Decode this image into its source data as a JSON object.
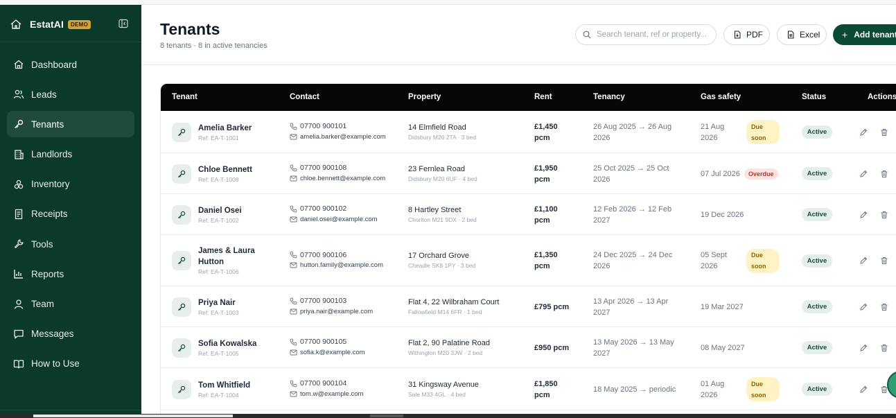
{
  "app": {
    "name": "EstatAI",
    "badge": "DEMO"
  },
  "sidebar": {
    "items": [
      {
        "label": "Dashboard",
        "icon": "home-icon",
        "active": false
      },
      {
        "label": "Leads",
        "icon": "users-icon",
        "active": false
      },
      {
        "label": "Tenants",
        "icon": "key-icon",
        "active": true
      },
      {
        "label": "Landlords",
        "icon": "building-icon",
        "active": false
      },
      {
        "label": "Inventory",
        "icon": "boxes-icon",
        "active": false
      },
      {
        "label": "Receipts",
        "icon": "receipt-icon",
        "active": false
      },
      {
        "label": "Tools",
        "icon": "wrench-icon",
        "active": false
      },
      {
        "label": "Reports",
        "icon": "bar-chart-icon",
        "active": false
      },
      {
        "label": "Team",
        "icon": "user-icon",
        "active": false
      },
      {
        "label": "Messages",
        "icon": "message-icon",
        "active": false
      },
      {
        "label": "How to Use",
        "icon": "book-icon",
        "active": false
      }
    ]
  },
  "header": {
    "title": "Tenants",
    "subtitle": "8 tenants · 8 in active tenancies",
    "search_placeholder": "Search tenant, ref or property...",
    "pdf_label": "PDF",
    "excel_label": "Excel",
    "add_label": "Add tenant"
  },
  "table": {
    "columns": [
      "Tenant",
      "Contact",
      "Property",
      "Rent",
      "Tenancy",
      "Gas safety",
      "Status",
      "Actions"
    ],
    "rows": [
      {
        "name": [
          "Amelia Barker"
        ],
        "ref": "Ref: EA-T-1001",
        "phone": "07700 900101",
        "email": "amelia.barker@example.com",
        "property": "14 Elmfield Road",
        "property_sub": "Didsbury M20 2TA · 3 bed",
        "rent": [
          "£1,450",
          "pcm"
        ],
        "tenancy": [
          "26 Aug 2025 → 26 Aug",
          "2026"
        ],
        "gas_date": [
          "21 Aug",
          "2026"
        ],
        "gas_badge": [
          "Due",
          "soon"
        ],
        "gas_type": "due",
        "status": "Active"
      },
      {
        "name": [
          "Chloe Bennett"
        ],
        "ref": "Ref: EA-T-1008",
        "phone": "07700 900108",
        "email": "chloe.bennett@example.com",
        "property": "23 Fernlea Road",
        "property_sub": "Didsbury M20 6UF · 4 bed",
        "rent": [
          "£1,950",
          "pcm"
        ],
        "tenancy": [
          "25 Oct 2025 → 25 Oct",
          "2026"
        ],
        "gas_date": [
          "07 Jul 2026"
        ],
        "gas_badge": [
          "Overdue"
        ],
        "gas_type": "overdue",
        "status": "Active"
      },
      {
        "name": [
          "Daniel Osei"
        ],
        "ref": "Ref: EA-T-1002",
        "phone": "07700 900102",
        "email": "daniel.osei@example.com",
        "property": "8 Hartley Street",
        "property_sub": "Chorlton M21 9DX · 2 bed",
        "rent": [
          "£1,100",
          "pcm"
        ],
        "tenancy": [
          "12 Feb 2026 → 12 Feb",
          "2027"
        ],
        "gas_date": [
          "19 Dec 2026"
        ],
        "gas_badge": [],
        "gas_type": "none",
        "status": "Active"
      },
      {
        "name": [
          "James & Laura",
          "Hutton"
        ],
        "ref": "Ref: EA-T-1006",
        "phone": "07700 900106",
        "email": "hutton.family@example.com",
        "property": "17 Orchard Grove",
        "property_sub": "Cheadle SK8 1PY · 3 bed",
        "rent": [
          "£1,350",
          "pcm"
        ],
        "tenancy": [
          "24 Dec 2025 → 24 Dec",
          "2026"
        ],
        "gas_date": [
          "05 Sept",
          "2026"
        ],
        "gas_badge": [
          "Due",
          "soon"
        ],
        "gas_type": "due",
        "status": "Active"
      },
      {
        "name": [
          "Priya Nair"
        ],
        "ref": "Ref: EA-T-1003",
        "phone": "07700 900103",
        "email": "priya.nair@example.com",
        "property": "Flat 4, 22 Wilbraham Court",
        "property_sub": "Fallowfield M14 6FR · 1 bed",
        "rent": [
          "£795 pcm"
        ],
        "tenancy": [
          "13 Apr 2026 → 13 Apr",
          "2027"
        ],
        "gas_date": [
          "19 Mar 2027"
        ],
        "gas_badge": [],
        "gas_type": "none",
        "status": "Active"
      },
      {
        "name": [
          "Sofia Kowalska"
        ],
        "ref": "Ref: EA-T-1005",
        "phone": "07700 900105",
        "email": "sofia.k@example.com",
        "property": "Flat 2, 90 Palatine Road",
        "property_sub": "Withington M20 3JW · 2 bed",
        "rent": [
          "£950 pcm"
        ],
        "tenancy": [
          "13 May 2026 → 13 May",
          "2027"
        ],
        "gas_date": [
          "08 May 2027"
        ],
        "gas_badge": [],
        "gas_type": "none",
        "status": "Active"
      },
      {
        "name": [
          "Tom Whitfield"
        ],
        "ref": "Ref: EA-T-1004",
        "phone": "07700 900104",
        "email": "tom.w@example.com",
        "property": "31 Kingsway Avenue",
        "property_sub": "Sale M33 4GL · 4 bed",
        "rent": [
          "£1,850",
          "pcm"
        ],
        "tenancy": [
          "18 May 2025 → periodic"
        ],
        "gas_date": [
          "01 Aug",
          "2026"
        ],
        "gas_badge": [
          "Due",
          "soon"
        ],
        "gas_type": "due",
        "status": "Active"
      }
    ]
  }
}
